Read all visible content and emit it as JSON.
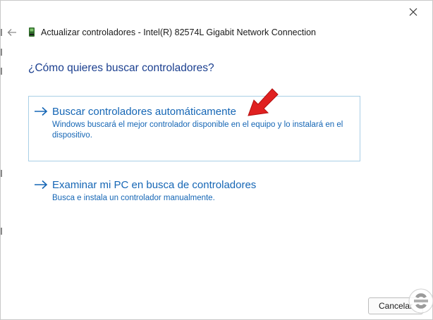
{
  "window": {
    "title": "Actualizar controladores - Intel(R) 82574L Gigabit Network Connection"
  },
  "heading": "¿Cómo quieres buscar controladores?",
  "options": [
    {
      "title": "Buscar controladores automáticamente",
      "description": "Windows buscará el mejor controlador disponible en el equipo y lo instalará en el dispositivo.",
      "icon": "arrow-right-icon",
      "selected": true
    },
    {
      "title": "Examinar mi PC en busca de controladores",
      "description": "Busca e instala un controlador manualmente.",
      "icon": "arrow-right-icon",
      "selected": false
    }
  ],
  "buttons": {
    "cancel": "Cancelar"
  },
  "colors": {
    "link_blue": "#1566b5",
    "heading_blue": "#1b3f8f",
    "selection_border": "#a9cfe6",
    "annotation_red": "#e02020"
  }
}
